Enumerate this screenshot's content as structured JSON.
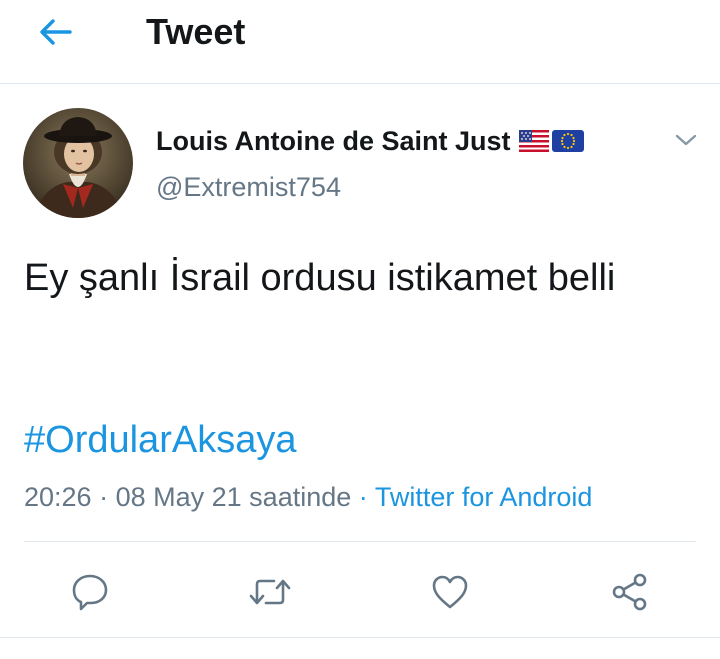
{
  "header": {
    "title": "Tweet",
    "back_icon": "arrow-left-icon"
  },
  "author": {
    "display_name": "Louis Antoine de Saint Just",
    "handle": "@Extremist754",
    "flags": [
      "us-flag-icon",
      "eu-flag-icon"
    ],
    "avatar": "portrait-avatar",
    "menu_icon": "chevron-down-icon"
  },
  "tweet": {
    "text": "Ey şanlı İsrail ordusu istikamet belli",
    "hashtag": "#OrdularAksaya",
    "time": "20:26",
    "separator_1": "·",
    "date": "08 May 21 saatinde",
    "separator_2": "·",
    "source": "Twitter for Android"
  },
  "actions": {
    "icons": [
      "reply-icon",
      "retweet-icon",
      "like-icon",
      "share-icon"
    ]
  },
  "colors": {
    "accent": "#1b95e0",
    "text": "#14171a",
    "secondary": "#657786",
    "divider": "#e1e8ed"
  }
}
